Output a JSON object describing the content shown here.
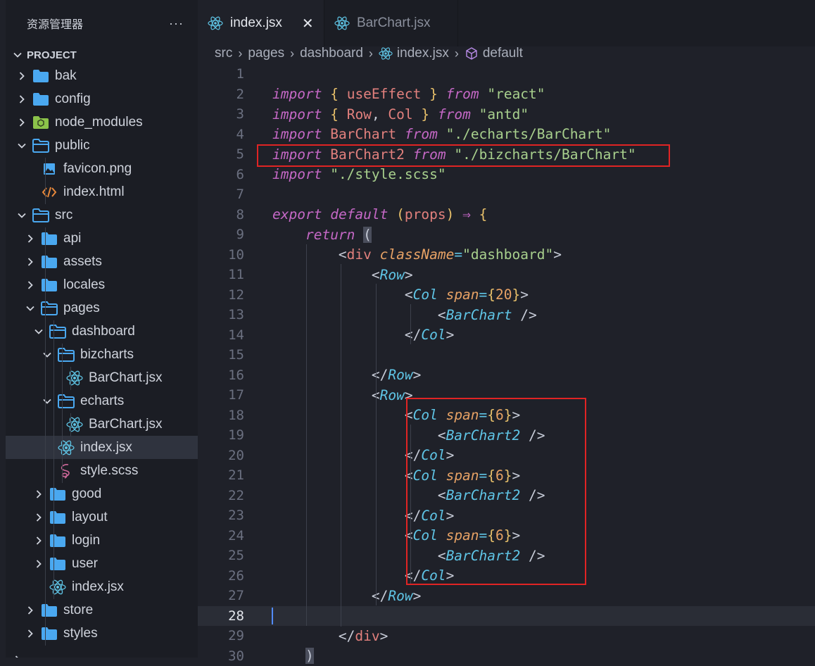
{
  "sidebar": {
    "title": "资源管理器",
    "more": "···",
    "project_label": "PROJECT",
    "items": [
      {
        "label": "bak",
        "kind": "folder",
        "expanded": false,
        "depth": 0
      },
      {
        "label": "config",
        "kind": "folder",
        "expanded": false,
        "depth": 0
      },
      {
        "label": "node_modules",
        "kind": "node-folder",
        "expanded": false,
        "depth": 0
      },
      {
        "label": "public",
        "kind": "folder",
        "expanded": true,
        "depth": 0
      },
      {
        "label": "favicon.png",
        "kind": "image-file",
        "depth": 1
      },
      {
        "label": "index.html",
        "kind": "html-file",
        "depth": 1
      },
      {
        "label": "src",
        "kind": "folder",
        "expanded": true,
        "depth": 0
      },
      {
        "label": "api",
        "kind": "folder",
        "expanded": false,
        "depth": 1
      },
      {
        "label": "assets",
        "kind": "folder",
        "expanded": false,
        "depth": 1
      },
      {
        "label": "locales",
        "kind": "folder",
        "expanded": false,
        "depth": 1
      },
      {
        "label": "pages",
        "kind": "folder",
        "expanded": true,
        "depth": 1
      },
      {
        "label": "dashboard",
        "kind": "folder",
        "expanded": true,
        "depth": 2
      },
      {
        "label": "bizcharts",
        "kind": "folder",
        "expanded": true,
        "depth": 3
      },
      {
        "label": "BarChart.jsx",
        "kind": "react-file",
        "depth": 4
      },
      {
        "label": "echarts",
        "kind": "folder",
        "expanded": true,
        "depth": 3
      },
      {
        "label": "BarChart.jsx",
        "kind": "react-file",
        "depth": 4
      },
      {
        "label": "index.jsx",
        "kind": "react-file",
        "depth": 3,
        "active": true
      },
      {
        "label": "style.scss",
        "kind": "sass-file",
        "depth": 3
      },
      {
        "label": "good",
        "kind": "folder",
        "expanded": false,
        "depth": 2
      },
      {
        "label": "layout",
        "kind": "folder",
        "expanded": false,
        "depth": 2
      },
      {
        "label": "login",
        "kind": "folder",
        "expanded": false,
        "depth": 2
      },
      {
        "label": "user",
        "kind": "folder",
        "expanded": false,
        "depth": 2
      },
      {
        "label": "index.jsx",
        "kind": "react-file",
        "depth": 2
      },
      {
        "label": "store",
        "kind": "folder",
        "expanded": false,
        "depth": 1
      },
      {
        "label": "styles",
        "kind": "folder",
        "expanded": false,
        "depth": 1
      }
    ]
  },
  "tabs": [
    {
      "label": "index.jsx",
      "active": true,
      "close": "✕"
    },
    {
      "label": "BarChart.jsx",
      "active": false
    }
  ],
  "breadcrumb": [
    "src",
    "pages",
    "dashboard",
    "index.jsx",
    "default"
  ],
  "editor": {
    "current_line": 28,
    "lines": [
      {
        "n": "1",
        "t": []
      },
      {
        "n": "2",
        "t": [
          [
            "kw",
            "import"
          ],
          [
            "pn",
            " "
          ],
          [
            "br",
            "{"
          ],
          [
            "pn",
            " "
          ],
          [
            "id",
            "useEffect"
          ],
          [
            "pn",
            " "
          ],
          [
            "br",
            "}"
          ],
          [
            "pn",
            " "
          ],
          [
            "kw",
            "from"
          ],
          [
            "pn",
            " "
          ],
          [
            "str",
            "\"react\""
          ]
        ]
      },
      {
        "n": "3",
        "t": [
          [
            "kw",
            "import"
          ],
          [
            "pn",
            " "
          ],
          [
            "br",
            "{"
          ],
          [
            "pn",
            " "
          ],
          [
            "id",
            "Row"
          ],
          [
            "pn",
            ", "
          ],
          [
            "id",
            "Col"
          ],
          [
            "pn",
            " "
          ],
          [
            "br",
            "}"
          ],
          [
            "pn",
            " "
          ],
          [
            "kw",
            "from"
          ],
          [
            "pn",
            " "
          ],
          [
            "str",
            "\"antd\""
          ]
        ]
      },
      {
        "n": "4",
        "t": [
          [
            "kw",
            "import"
          ],
          [
            "pn",
            " "
          ],
          [
            "id",
            "BarChart"
          ],
          [
            "pn",
            " "
          ],
          [
            "kw",
            "from"
          ],
          [
            "pn",
            " "
          ],
          [
            "str",
            "\"./echarts/BarChart\""
          ]
        ]
      },
      {
        "n": "5",
        "t": [
          [
            "kw",
            "import"
          ],
          [
            "pn",
            " "
          ],
          [
            "id",
            "BarChart2"
          ],
          [
            "pn",
            " "
          ],
          [
            "kw",
            "from"
          ],
          [
            "pn",
            " "
          ],
          [
            "str",
            "\"./bizcharts/BarChart\""
          ]
        ]
      },
      {
        "n": "6",
        "t": [
          [
            "kw",
            "import"
          ],
          [
            "pn",
            " "
          ],
          [
            "str",
            "\"./style.scss\""
          ]
        ]
      },
      {
        "n": "7",
        "t": []
      },
      {
        "n": "8",
        "t": [
          [
            "kw",
            "export"
          ],
          [
            "pn",
            " "
          ],
          [
            "kw",
            "default"
          ],
          [
            "pn",
            " "
          ],
          [
            "br",
            "("
          ],
          [
            "id",
            "props"
          ],
          [
            "br",
            ")"
          ],
          [
            "pn",
            " "
          ],
          [
            "kwn",
            "⇒"
          ],
          [
            "pn",
            " "
          ],
          [
            "br",
            "{"
          ]
        ]
      },
      {
        "n": "9",
        "t": [
          [
            "pn",
            "    "
          ],
          [
            "kw",
            "return"
          ],
          [
            "pn",
            " "
          ],
          [
            "paren-hl",
            "("
          ]
        ]
      },
      {
        "n": "10",
        "t": [
          [
            "pn",
            "        "
          ],
          [
            "pn",
            "<"
          ],
          [
            "tag",
            "div"
          ],
          [
            "pn",
            " "
          ],
          [
            "attr",
            "className"
          ],
          [
            "op",
            "="
          ],
          [
            "str",
            "\"dashboard\""
          ],
          [
            "pn",
            ">"
          ]
        ]
      },
      {
        "n": "11",
        "t": [
          [
            "pn",
            "            "
          ],
          [
            "pn",
            "<"
          ],
          [
            "comp",
            "Row"
          ],
          [
            "pn",
            ">"
          ]
        ]
      },
      {
        "n": "12",
        "t": [
          [
            "pn",
            "                "
          ],
          [
            "pn",
            "<"
          ],
          [
            "comp",
            "Col"
          ],
          [
            "pn",
            " "
          ],
          [
            "attr",
            "span"
          ],
          [
            "op",
            "="
          ],
          [
            "br",
            "{"
          ],
          [
            "num",
            "20"
          ],
          [
            "br",
            "}"
          ],
          [
            "pn",
            ">"
          ]
        ]
      },
      {
        "n": "13",
        "t": [
          [
            "pn",
            "                    "
          ],
          [
            "pn",
            "<"
          ],
          [
            "comp",
            "BarChart"
          ],
          [
            "pn",
            " />"
          ]
        ]
      },
      {
        "n": "14",
        "t": [
          [
            "pn",
            "                "
          ],
          [
            "pn",
            "</"
          ],
          [
            "comp",
            "Col"
          ],
          [
            "pn",
            ">"
          ]
        ]
      },
      {
        "n": "15",
        "t": []
      },
      {
        "n": "16",
        "t": [
          [
            "pn",
            "            "
          ],
          [
            "pn",
            "</"
          ],
          [
            "comp",
            "Row"
          ],
          [
            "pn",
            ">"
          ]
        ]
      },
      {
        "n": "17",
        "t": [
          [
            "pn",
            "            "
          ],
          [
            "pn",
            "<"
          ],
          [
            "comp",
            "Row"
          ],
          [
            "pn",
            ">"
          ]
        ]
      },
      {
        "n": "18",
        "t": [
          [
            "pn",
            "                "
          ],
          [
            "pn",
            "<"
          ],
          [
            "comp",
            "Col"
          ],
          [
            "pn",
            " "
          ],
          [
            "attr",
            "span"
          ],
          [
            "op",
            "="
          ],
          [
            "br",
            "{"
          ],
          [
            "num",
            "6"
          ],
          [
            "br",
            "}"
          ],
          [
            "pn",
            ">"
          ]
        ]
      },
      {
        "n": "19",
        "t": [
          [
            "pn",
            "                    "
          ],
          [
            "pn",
            "<"
          ],
          [
            "comp",
            "BarChart2"
          ],
          [
            "pn",
            " />"
          ]
        ]
      },
      {
        "n": "20",
        "t": [
          [
            "pn",
            "                "
          ],
          [
            "pn",
            "</"
          ],
          [
            "comp",
            "Col"
          ],
          [
            "pn",
            ">"
          ]
        ]
      },
      {
        "n": "21",
        "t": [
          [
            "pn",
            "                "
          ],
          [
            "pn",
            "<"
          ],
          [
            "comp",
            "Col"
          ],
          [
            "pn",
            " "
          ],
          [
            "attr",
            "span"
          ],
          [
            "op",
            "="
          ],
          [
            "br",
            "{"
          ],
          [
            "num",
            "6"
          ],
          [
            "br",
            "}"
          ],
          [
            "pn",
            ">"
          ]
        ]
      },
      {
        "n": "22",
        "t": [
          [
            "pn",
            "                    "
          ],
          [
            "pn",
            "<"
          ],
          [
            "comp",
            "BarChart2"
          ],
          [
            "pn",
            " />"
          ]
        ]
      },
      {
        "n": "23",
        "t": [
          [
            "pn",
            "                "
          ],
          [
            "pn",
            "</"
          ],
          [
            "comp",
            "Col"
          ],
          [
            "pn",
            ">"
          ]
        ]
      },
      {
        "n": "24",
        "t": [
          [
            "pn",
            "                "
          ],
          [
            "pn",
            "<"
          ],
          [
            "comp",
            "Col"
          ],
          [
            "pn",
            " "
          ],
          [
            "attr",
            "span"
          ],
          [
            "op",
            "="
          ],
          [
            "br",
            "{"
          ],
          [
            "num",
            "6"
          ],
          [
            "br",
            "}"
          ],
          [
            "pn",
            ">"
          ]
        ]
      },
      {
        "n": "25",
        "t": [
          [
            "pn",
            "                    "
          ],
          [
            "pn",
            "<"
          ],
          [
            "comp",
            "BarChart2"
          ],
          [
            "pn",
            " />"
          ]
        ]
      },
      {
        "n": "26",
        "t": [
          [
            "pn",
            "                "
          ],
          [
            "pn",
            "</"
          ],
          [
            "comp",
            "Col"
          ],
          [
            "pn",
            ">"
          ]
        ]
      },
      {
        "n": "27",
        "t": [
          [
            "pn",
            "            "
          ],
          [
            "pn",
            "</"
          ],
          [
            "comp",
            "Row"
          ],
          [
            "pn",
            ">"
          ]
        ]
      },
      {
        "n": "28",
        "t": []
      },
      {
        "n": "29",
        "t": [
          [
            "pn",
            "        "
          ],
          [
            "pn",
            "</"
          ],
          [
            "tag",
            "div"
          ],
          [
            "pn",
            ">"
          ]
        ]
      },
      {
        "n": "30",
        "t": [
          [
            "pn",
            "    "
          ],
          [
            "paren-hl",
            ")"
          ]
        ]
      }
    ]
  },
  "colors": {
    "highlight_box": "#e02424",
    "accent_blue": "#4aa8f0"
  }
}
